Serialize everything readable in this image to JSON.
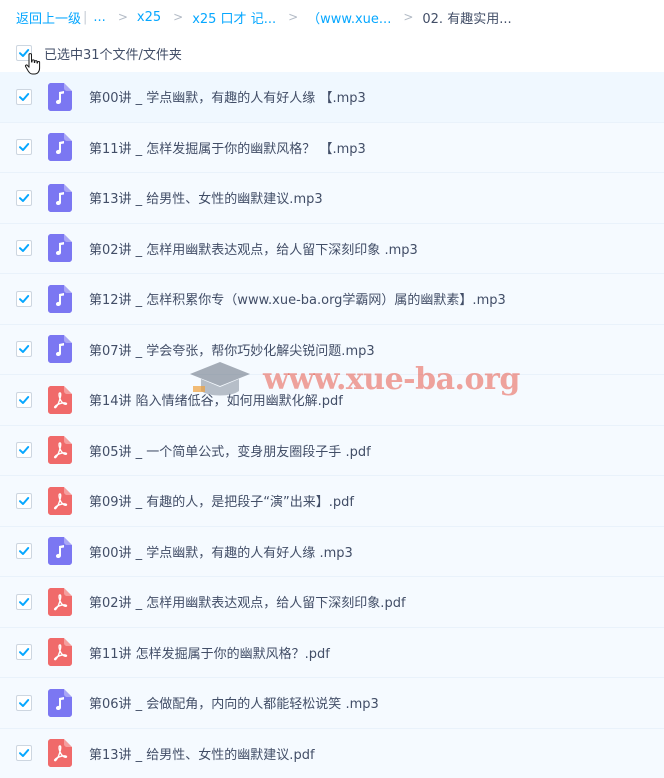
{
  "breadcrumb": {
    "back": "返回上一级",
    "ellipsis": "...",
    "items": [
      "x25",
      "x25 口才 记...",
      "（www.xue...",
      "02. 有趣实用..."
    ]
  },
  "selection": {
    "label": "已选中31个文件/文件夹"
  },
  "colors": {
    "accent": "#06a7ff",
    "audio_icon": "#7b77f2",
    "pdf_icon": "#f06a6a",
    "row_bg": "#f5faff"
  },
  "files": [
    {
      "name": "第00讲 _ 学点幽默，有趣的人有好人缘 【.mp3",
      "type": "audio"
    },
    {
      "name": "第11讲 _ 怎样发掘属于你的幽默风格？ 【.mp3",
      "type": "audio"
    },
    {
      "name": "第13讲 _ 给男性、女性的幽默建议.mp3",
      "type": "audio"
    },
    {
      "name": "第02讲 _ 怎样用幽默表达观点，给人留下深刻印象 .mp3",
      "type": "audio"
    },
    {
      "name": "第12讲 _ 怎样积累你专（www.xue-ba.org学霸网）属的幽默素】.mp3",
      "type": "audio"
    },
    {
      "name": "第07讲 _ 学会夸张，帮你巧妙化解尖锐问题.mp3",
      "type": "audio"
    },
    {
      "name": "第14讲 陷入情绪低谷，如何用幽默化解.pdf",
      "type": "pdf"
    },
    {
      "name": "第05讲 _ 一个简单公式，变身朋友圈段子手 .pdf",
      "type": "pdf"
    },
    {
      "name": "第09讲 _ 有趣的人，是把段子“演”出来】.pdf",
      "type": "pdf"
    },
    {
      "name": "第00讲 _ 学点幽默，有趣的人有好人缘 .mp3",
      "type": "audio"
    },
    {
      "name": "第02讲 _ 怎样用幽默表达观点，给人留下深刻印象.pdf",
      "type": "pdf"
    },
    {
      "name": "第11讲 怎样发掘属于你的幽默风格？.pdf",
      "type": "pdf"
    },
    {
      "name": "第06讲 _ 会做配角，内向的人都能轻松说笑 .mp3",
      "type": "audio"
    },
    {
      "name": "第13讲 _ 给男性、女性的幽默建议.pdf",
      "type": "pdf"
    }
  ],
  "watermark": {
    "text": "www.xue-ba.org"
  }
}
